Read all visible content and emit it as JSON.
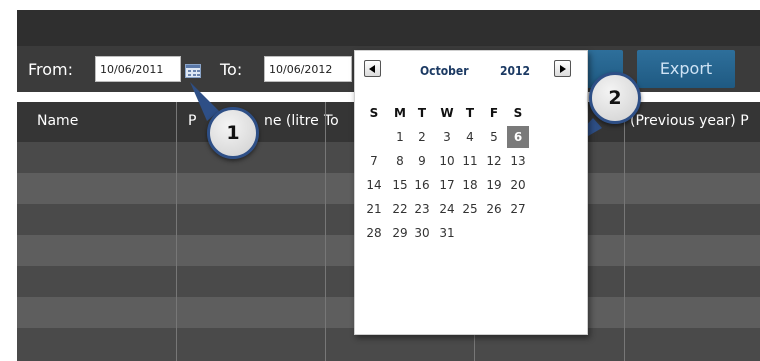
{
  "toolbar": {
    "from_label": "From:",
    "from_value": "10/06/2011",
    "to_label": "To:",
    "to_value": "10/06/2012",
    "export_label": "Export",
    "calendar_icon": "calendar-icon"
  },
  "grid": {
    "headers": [
      "Name",
      "P",
      "ne (litre",
      "To",
      "(Previous year) P"
    ]
  },
  "datepicker": {
    "month": "October",
    "year": "2012",
    "weekdays": [
      "S",
      "M",
      "T",
      "W",
      "T",
      "F",
      "S"
    ],
    "weeks": [
      [
        "",
        "1",
        "2",
        "3",
        "4",
        "5",
        "6"
      ],
      [
        "7",
        "8",
        "9",
        "10",
        "11",
        "12",
        "13"
      ],
      [
        "14",
        "15",
        "16",
        "17",
        "18",
        "19",
        "20"
      ],
      [
        "21",
        "22",
        "23",
        "24",
        "25",
        "26",
        "27"
      ],
      [
        "28",
        "29",
        "30",
        "31",
        "",
        "",
        ""
      ]
    ],
    "selected_day": "6",
    "prev_icon": "prev-month-icon",
    "next_icon": "next-month-icon"
  },
  "callouts": [
    "1",
    "2"
  ],
  "colors": {
    "toolbar_bg": "#3b3b3b",
    "grid_row_dark": "#4a4a4a",
    "grid_row_light": "#5e5e5e",
    "button_blue": "#2a6590",
    "selected_day_bg": "#7a7a7a",
    "callout_border": "#2e4f86"
  }
}
